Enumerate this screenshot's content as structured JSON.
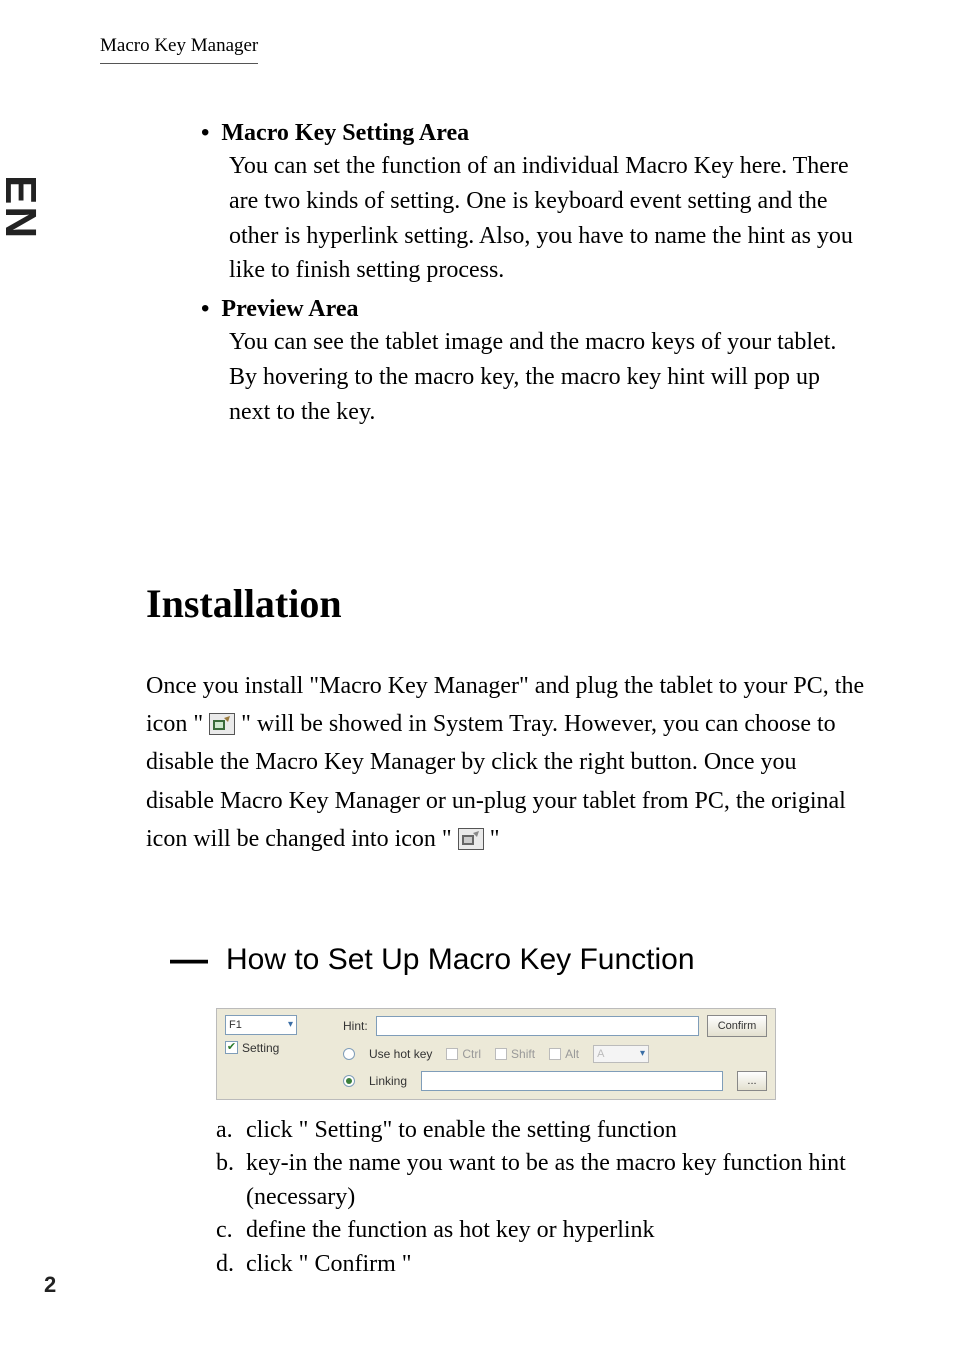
{
  "header": {
    "title": "Macro Key Manager"
  },
  "sidebar": {
    "lang": "EN"
  },
  "bullets": {
    "item1": {
      "title": "Macro Key Setting Area",
      "body": "You can set the function of an individual Macro Key here. There are two kinds of setting. One is keyboard event setting and the other is hyperlink setting. Also, you have to name the hint as you like to finish setting process."
    },
    "item2": {
      "title": "Preview Area",
      "body": "You can see the tablet image and the macro keys of your tablet. By hovering to the macro key, the macro key hint will pop up next to the key."
    }
  },
  "install": {
    "heading": "Installation",
    "p1a": "Once you install \"Macro Key Manager\" and plug the tablet to your PC, the icon \"",
    "p1b": "\" will be showed in System Tray. However, you can choose to disable the Macro Key Manager by click the right button. Once you disable Macro Key Manager or un-plug your tablet from PC, the original icon will be changed into icon \"",
    "p1c": "\""
  },
  "howto": {
    "dash": "—",
    "title": "How to Set Up Macro Key Function"
  },
  "ui": {
    "combo_value": "F1",
    "setting_label": "Setting",
    "hint_label": "Hint:",
    "confirm": "Confirm",
    "use_hot_key": "Use hot key",
    "linking": "Linking",
    "ctrl": "Ctrl",
    "shift": "Shift",
    "alt": "Alt",
    "mod_combo": "A",
    "browse": "..."
  },
  "steps": {
    "a_letter": "a.",
    "a": "click \" Setting\" to enable the setting function",
    "b_letter": "b.",
    "b": "key-in the name you want to be as the macro key function hint (necessary)",
    "c_letter": "c.",
    "c": "define the function as hot key or hyperlink",
    "d_letter": "d.",
    "d": "click \" Confirm \""
  },
  "page_number": "2"
}
